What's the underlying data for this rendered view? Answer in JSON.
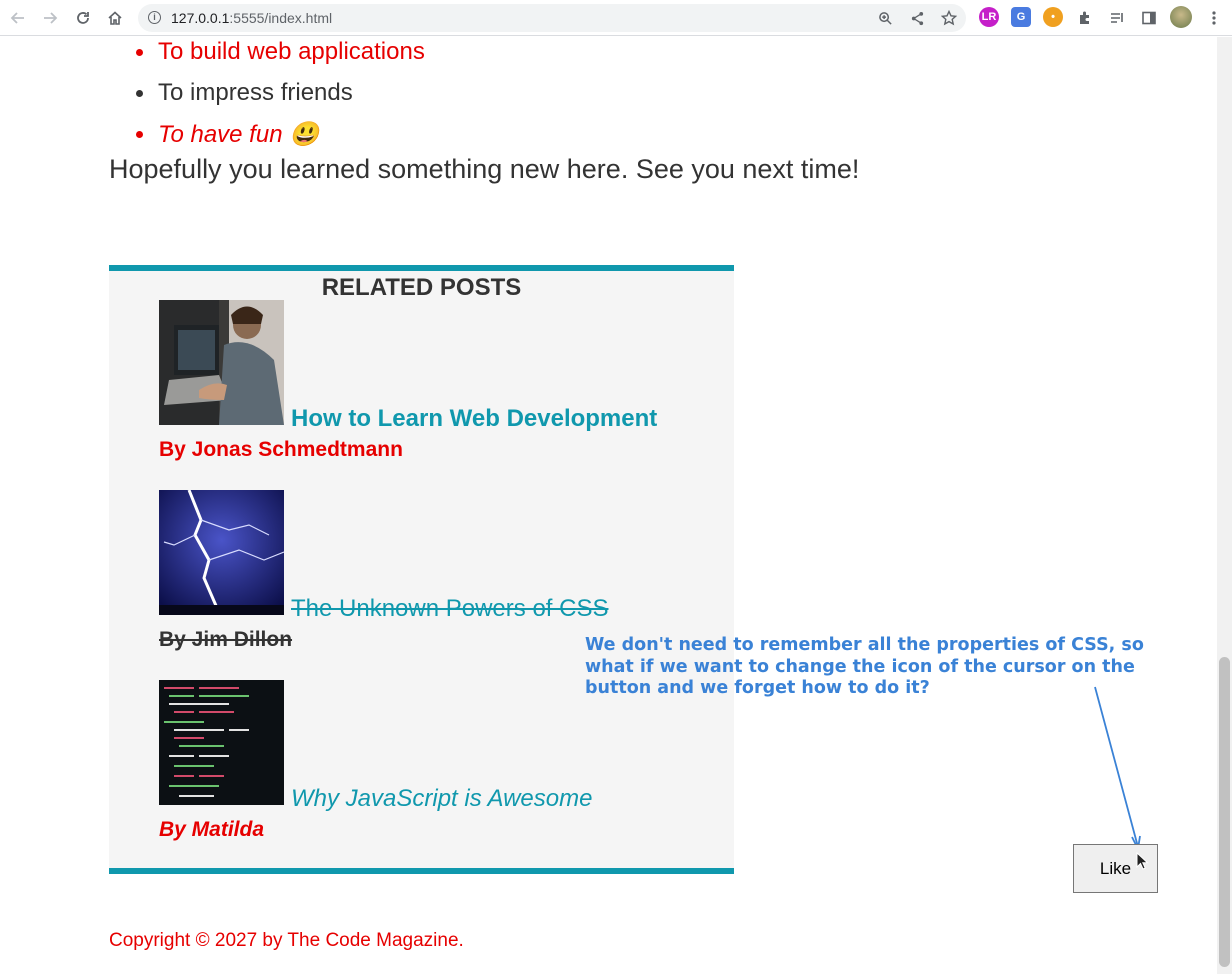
{
  "browser": {
    "url_host": "127.0.0.1",
    "url_rest": ":5555/index.html",
    "icons": [
      "back-icon",
      "forward-icon",
      "reload-icon",
      "home-icon",
      "info-icon",
      "zoom-icon",
      "share-icon",
      "bookmark-star-icon",
      "extension-icon",
      "reading-list-icon",
      "side-panel-icon",
      "profile-avatar",
      "menu-icon"
    ]
  },
  "article": {
    "list_items": [
      {
        "text": "To build web applications",
        "style": "red"
      },
      {
        "text": "To impress friends",
        "style": "plain"
      },
      {
        "text": "To have fun 😃",
        "style": "red-italic"
      }
    ],
    "closing": "Hopefully you learned something new here. See you next time!"
  },
  "related": {
    "title": "RELATED POSTS",
    "posts": [
      {
        "title": "How to Learn Web Development",
        "author": "By Jonas Schmedtmann",
        "image": "developer-photo"
      },
      {
        "title": "The Unknown Powers of CSS",
        "author": "By Jim Dillon",
        "image": "lightning-photo"
      },
      {
        "title": "Why JavaScript is Awesome",
        "author": "By Matilda",
        "image": "code-screen-photo"
      }
    ]
  },
  "like_button": {
    "label": "Like"
  },
  "annotation": {
    "text": "We don't need to remember all the properties of CSS, so what if we want to change the icon of the cursor on the button and we forget how to do it?",
    "color": "#3a82d6"
  },
  "footer": {
    "copyright": "Copyright © 2027 by The Code Magazine."
  },
  "colors": {
    "accent": "#1098ad",
    "red": "#e60000",
    "text": "#333333"
  }
}
